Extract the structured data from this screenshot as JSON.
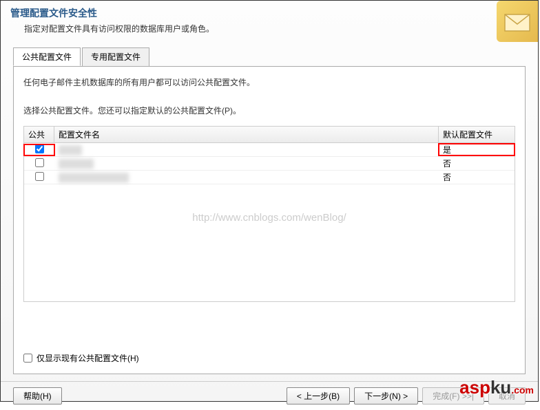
{
  "header": {
    "title": "管理配置文件安全性",
    "desc": "指定对配置文件具有访问权限的数据库用户或角色。"
  },
  "tabs": {
    "public": "公共配置文件",
    "private": "专用配置文件"
  },
  "panel": {
    "desc1": "任何电子邮件主机数据库的所有用户都可以访问公共配置文件。",
    "desc2": "选择公共配置文件。您还可以指定默认的公共配置文件(P)。"
  },
  "grid": {
    "header": {
      "public": "公共",
      "name": "配置文件名",
      "default": "默认配置文件"
    },
    "rows": [
      {
        "checked": true,
        "name": "████",
        "default": "是",
        "highlight": true
      },
      {
        "checked": false,
        "name": "██████",
        "default": "否",
        "highlight": false
      },
      {
        "checked": false,
        "name": "████████████",
        "default": "否",
        "highlight": false
      }
    ]
  },
  "watermark": "http://www.cnblogs.com/wenBlog/",
  "showOnly": "仅显示现有公共配置文件(H)",
  "footer": {
    "help": "帮助(H)",
    "back": "< 上一步(B)",
    "next": "下一步(N) >",
    "finish": "完成(F) >>|",
    "cancel": "取消"
  }
}
